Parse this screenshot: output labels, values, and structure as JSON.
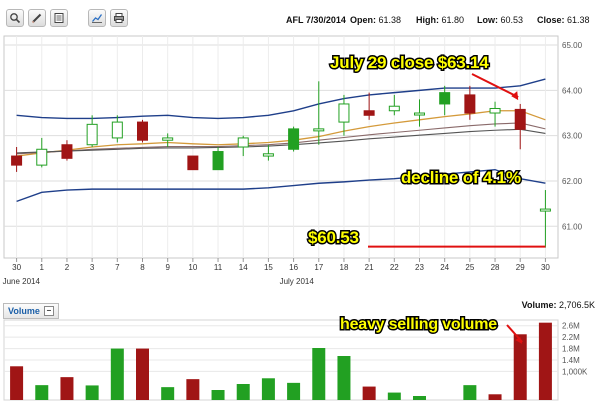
{
  "toolbar": {
    "buttons": [
      "zoom-icon",
      "draw-icon",
      "list-icon",
      "chart-icon",
      "print-icon"
    ]
  },
  "quote": {
    "symbol_date": "AFL 7/30/2014",
    "open_label": "Open:",
    "open": "61.38",
    "high_label": "High:",
    "high": "61.80",
    "low_label": "Low:",
    "low": "60.53",
    "close_label": "Close:",
    "close": "61.38"
  },
  "volume": {
    "label": "Volume",
    "value_label": "Volume:",
    "value": "2,706.5K"
  },
  "annotations": {
    "close_note": "July 29 close $63.14",
    "decline_note": "decline of 4.1%",
    "low_note": "$60.53",
    "volume_note": "heavy selling volume"
  },
  "colors": {
    "up": "#22a022",
    "down": "#a01515",
    "band": "#1f3f8a",
    "ma_short": "#d49a3a",
    "ma_mid": "#8a6a6a",
    "ma_long": "#555555",
    "arrow": "#e01010"
  },
  "chart_data": [
    {
      "type": "candlestick",
      "title": "AFL 7/30/2014",
      "categories": [
        "30",
        "1",
        "2",
        "3",
        "7",
        "8",
        "9",
        "10",
        "11",
        "14",
        "15",
        "16",
        "17",
        "18",
        "21",
        "22",
        "23",
        "24",
        "25",
        "28",
        "29",
        "30"
      ],
      "month_labels": [
        {
          "at": "30",
          "text": "June 2014"
        },
        {
          "at": "16",
          "text": "July 2014"
        }
      ],
      "ylim": [
        60.3,
        65.2
      ],
      "yticks": [
        "65.00",
        "64.00",
        "63.00",
        "62.00",
        "61.00"
      ],
      "yticks_values": [
        65,
        64,
        63,
        62,
        61
      ],
      "grid": true,
      "candles": [
        {
          "o": 62.55,
          "h": 62.75,
          "l": 62.2,
          "c": 62.35
        },
        {
          "o": 62.35,
          "h": 62.95,
          "l": 62.3,
          "c": 62.7
        },
        {
          "o": 62.8,
          "h": 62.9,
          "l": 62.45,
          "c": 62.5
        },
        {
          "o": 62.8,
          "h": 63.45,
          "l": 62.75,
          "c": 63.25
        },
        {
          "o": 62.95,
          "h": 63.45,
          "l": 62.85,
          "c": 63.3
        },
        {
          "o": 63.3,
          "h": 63.35,
          "l": 62.85,
          "c": 62.9
        },
        {
          "o": 62.9,
          "h": 63.05,
          "l": 62.75,
          "c": 62.95
        },
        {
          "o": 62.55,
          "h": 62.55,
          "l": 62.25,
          "c": 62.25
        },
        {
          "o": 62.25,
          "h": 62.75,
          "l": 62.25,
          "c": 62.65
        },
        {
          "o": 62.75,
          "h": 63.0,
          "l": 62.55,
          "c": 62.95
        },
        {
          "o": 62.55,
          "h": 62.8,
          "l": 62.45,
          "c": 62.6
        },
        {
          "o": 62.7,
          "h": 63.2,
          "l": 62.65,
          "c": 63.15
        },
        {
          "o": 63.15,
          "h": 64.2,
          "l": 62.8,
          "c": 63.15
        },
        {
          "o": 63.3,
          "h": 63.9,
          "l": 63.0,
          "c": 63.7
        },
        {
          "o": 63.55,
          "h": 63.95,
          "l": 63.35,
          "c": 63.45
        },
        {
          "o": 63.55,
          "h": 63.9,
          "l": 63.45,
          "c": 63.65
        },
        {
          "o": 63.5,
          "h": 63.8,
          "l": 63.2,
          "c": 63.5
        },
        {
          "o": 63.7,
          "h": 64.1,
          "l": 63.45,
          "c": 63.95
        },
        {
          "o": 63.9,
          "h": 64.1,
          "l": 63.35,
          "c": 63.5
        },
        {
          "o": 63.5,
          "h": 63.75,
          "l": 63.2,
          "c": 63.6
        },
        {
          "o": 63.58,
          "h": 63.7,
          "l": 62.7,
          "c": 63.14
        },
        {
          "o": 61.38,
          "h": 61.8,
          "l": 60.53,
          "c": 61.38
        }
      ],
      "overlays": [
        {
          "kind": "bollinger-upper",
          "values": [
            63.45,
            63.4,
            63.38,
            63.38,
            63.4,
            63.43,
            63.45,
            63.4,
            63.38,
            63.4,
            63.45,
            63.55,
            63.7,
            63.82,
            63.9,
            63.95,
            64.0,
            64.05,
            64.05,
            64.05,
            64.1,
            64.25
          ]
        },
        {
          "kind": "bollinger-lower",
          "values": [
            61.55,
            61.75,
            61.8,
            61.82,
            61.82,
            61.82,
            61.82,
            61.82,
            61.82,
            61.82,
            61.85,
            61.9,
            61.95,
            61.98,
            62.02,
            62.05,
            62.1,
            62.15,
            62.2,
            62.25,
            62.05,
            61.95
          ]
        },
        {
          "kind": "ma-short",
          "values": [
            62.55,
            62.62,
            62.68,
            62.75,
            62.8,
            62.82,
            62.85,
            62.82,
            62.8,
            62.82,
            62.85,
            62.9,
            62.98,
            63.1,
            63.2,
            63.28,
            63.35,
            63.42,
            63.48,
            63.55,
            63.55,
            63.35
          ]
        },
        {
          "kind": "ma-mid",
          "values": [
            62.6,
            62.63,
            62.66,
            62.7,
            62.72,
            62.74,
            62.76,
            62.76,
            62.76,
            62.78,
            62.8,
            62.84,
            62.9,
            62.96,
            63.02,
            63.07,
            63.12,
            63.17,
            63.22,
            63.26,
            63.28,
            63.15
          ]
        },
        {
          "kind": "ma-long",
          "values": [
            62.62,
            62.64,
            62.66,
            62.68,
            62.7,
            62.72,
            62.73,
            62.73,
            62.74,
            62.75,
            62.77,
            62.8,
            62.84,
            62.88,
            62.93,
            62.97,
            63.01,
            63.05,
            63.09,
            63.12,
            63.14,
            63.05
          ]
        }
      ]
    },
    {
      "type": "bar",
      "title": "Volume",
      "categories": [
        "30",
        "1",
        "2",
        "3",
        "7",
        "8",
        "9",
        "10",
        "11",
        "14",
        "15",
        "16",
        "17",
        "18",
        "21",
        "22",
        "23",
        "24",
        "25",
        "28",
        "29",
        "30"
      ],
      "ylim": [
        0,
        2800
      ],
      "yticks": [
        "2.6M",
        "2.2M",
        "1.8M",
        "1.4M",
        "1,000K"
      ],
      "yticks_values": [
        2600,
        2200,
        1800,
        1400,
        1000
      ],
      "values": [
        1180,
        520,
        800,
        510,
        1800,
        1800,
        450,
        730,
        350,
        560,
        760,
        600,
        1820,
        1540,
        470,
        260,
        140,
        0,
        520,
        200,
        2300,
        2706.5
      ],
      "directions": [
        "down",
        "up",
        "down",
        "up",
        "up",
        "down",
        "up",
        "down",
        "up",
        "up",
        "up",
        "up",
        "up",
        "up",
        "down",
        "up",
        "up",
        "up",
        "up",
        "down",
        "down",
        "down"
      ]
    }
  ]
}
